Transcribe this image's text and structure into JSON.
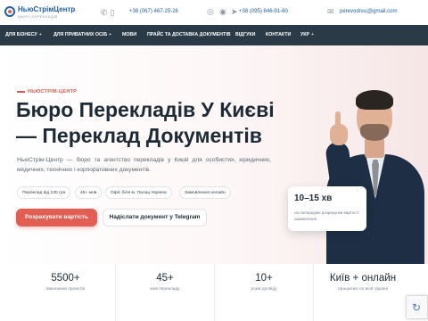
{
  "header": {
    "logo_title": "НьюСтрімЦентр",
    "logo_subtitle": "БЮРО ПЕРЕКЛАДІВ",
    "phone1": "+38 (067) 467-25-26",
    "phone2": "+38 (095) 846-91-60",
    "email": "perevodnsc@gmail.com",
    "icons": {
      "phone": "phone-icon",
      "mobile": "mobile-icon",
      "viber": "viber-icon",
      "whatsapp": "whatsapp-icon",
      "telegram": "telegram-icon",
      "email": "mail-icon"
    }
  },
  "nav": {
    "items": [
      {
        "label": "ДЛЯ БІЗНЕСУ",
        "has_submenu": true
      },
      {
        "label": "ДЛЯ ПРИВАТНИХ ОСІБ",
        "has_submenu": true
      },
      {
        "label": "МОВИ",
        "has_submenu": false
      },
      {
        "label": "ПРАЙС ТА ДОСТАВКА ДОКУМЕНТІВ",
        "has_submenu": false
      },
      {
        "label": "ВІДГУКИ",
        "has_submenu": false
      },
      {
        "label": "КОНТАКТИ",
        "has_submenu": false
      },
      {
        "label": "УКР",
        "has_submenu": true
      }
    ],
    "plus": "+"
  },
  "hero": {
    "eyebrow": "НЬЮСТРІМ-ЦЕНТР",
    "title": "Бюро Перекладів У Києві — Переклад Документів",
    "lead": "НьюСтрім-Центр — бюро та агентство перекладів у Києві для особистих, юридичних, медичних, технічних і корпоративних документів.",
    "tags": [
      "Переклад від 130 грн",
      "45+ мов",
      "Офіс біля м. Палац Україна",
      "Замовлення онлайн"
    ],
    "primary_button": "Розрахувати вартість",
    "secondary_button": "Надіслати документ у Telegram",
    "badge_value": "10–15 хв",
    "badge_text": "на попередню розрахунки вартості замовлення"
  },
  "stats": [
    {
      "value": "5500+",
      "label": "виконаних проектів"
    },
    {
      "value": "45+",
      "label": "мов перекладу"
    },
    {
      "value": "10+",
      "label": "років досвіду"
    },
    {
      "value": "Київ + онлайн",
      "label": "працюємо по всій Україні"
    }
  ],
  "colors": {
    "accent": "#e25d52",
    "nav_bg": "#2a3a47",
    "brand_blue": "#1e5fa8"
  }
}
